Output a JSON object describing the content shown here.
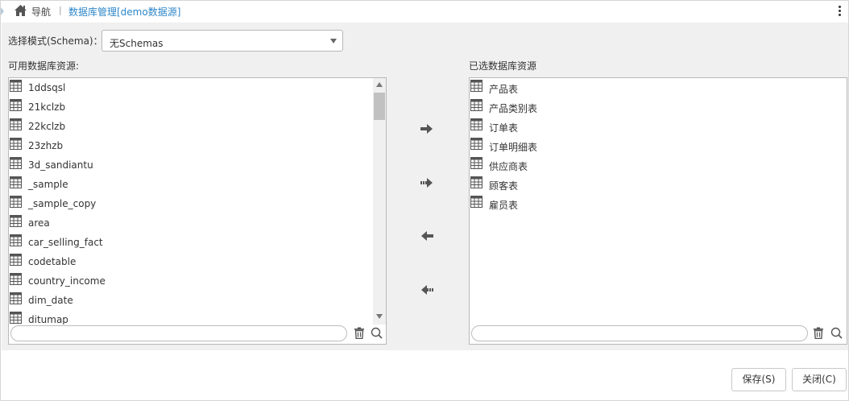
{
  "header": {
    "nav_label": "导航",
    "separator": "|",
    "current": "数据库管理[demo数据源]"
  },
  "schema": {
    "label": "选择模式(Schema)：",
    "value": "无Schemas"
  },
  "available": {
    "heading": "可用数据库资源:",
    "items": [
      "1ddsqsl",
      "21kclzb",
      "22kclzb",
      "23zhzb",
      "3d_sandiantu",
      "_sample",
      "_sample_copy",
      "area",
      "car_selling_fact",
      "codetable",
      "country_income",
      "dim_date",
      "ditumap"
    ],
    "filter_value": ""
  },
  "selected": {
    "heading": "已选数据库资源",
    "items": [
      "产品表",
      "产品类别表",
      "订单表",
      "订单明细表",
      "供应商表",
      "顾客表",
      "雇员表"
    ],
    "filter_value": ""
  },
  "buttons": {
    "save": "保存(S)",
    "close": "关闭(C)"
  },
  "icons": {
    "home": "home-icon",
    "kebab": "more-vertical-icon",
    "table": "table-icon",
    "trash": "trash-icon",
    "search": "search-icon",
    "add": "arrow-right-icon",
    "add_all": "double-arrow-right-icon",
    "remove": "arrow-left-icon",
    "remove_all": "double-arrow-left-icon"
  },
  "colors": {
    "link": "#2d86c9",
    "panel_bg": "#f0f0f0",
    "icon": "#555555"
  }
}
